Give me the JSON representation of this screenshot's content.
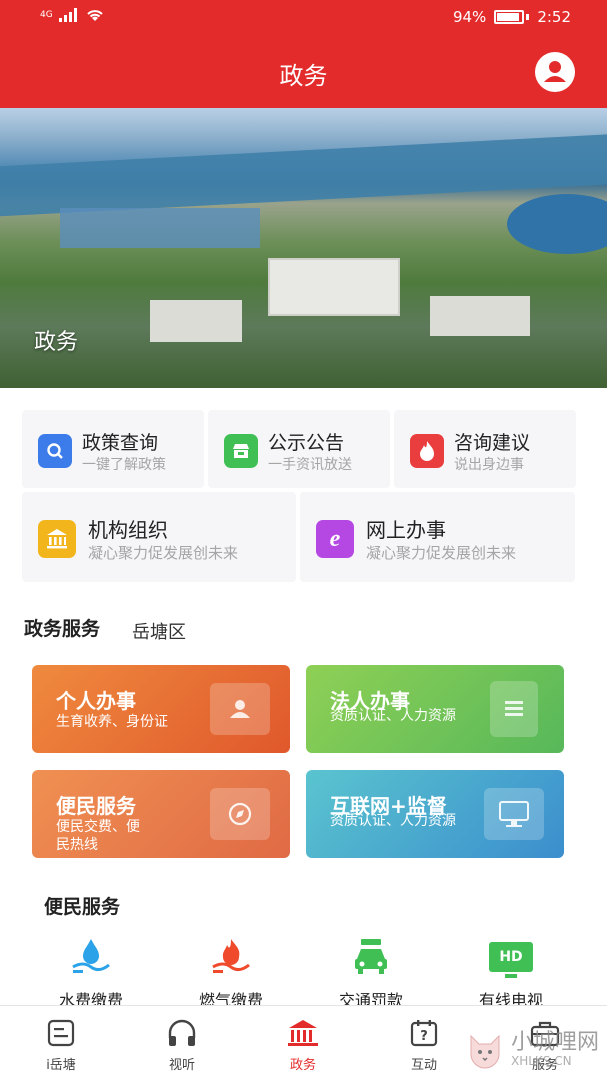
{
  "status_bar": {
    "signal": "4G",
    "battery": "94%",
    "time": "2:52"
  },
  "header": {
    "title": "政务"
  },
  "banner": {
    "label": "政务"
  },
  "quick_links": [
    {
      "title": "政策查询",
      "subtitle": "一键了解政策",
      "color": "#3b7bea"
    },
    {
      "title": "公示公告",
      "subtitle": "一手资讯放送",
      "color": "#3fbf54"
    },
    {
      "title": "咨询建议",
      "subtitle": "说出身边事",
      "color": "#ea3d3d"
    },
    {
      "title": "机构组织",
      "subtitle": "凝心聚力促发展创未来",
      "color": "#f2b51c"
    },
    {
      "title": "网上办事",
      "subtitle": "凝心聚力促发展创未来",
      "color": "#b548e3"
    }
  ],
  "services_section": {
    "title": "政务服务",
    "region": "岳塘区"
  },
  "services": [
    {
      "title": "个人办事",
      "desc": "生育收养、身份证",
      "color_from": "#ef8a3e",
      "color_to": "#e0582c"
    },
    {
      "title": "法人办事",
      "desc": "资质认证、人力资源",
      "color_from": "#8fd055",
      "color_to": "#57b85a"
    },
    {
      "title": "便民服务",
      "desc": "便民交费、便民热线",
      "color_from": "#f09052",
      "color_to": "#e06a45"
    },
    {
      "title": "互联网+监督",
      "desc": "资质认证、人力资源",
      "color_from": "#5ac4cf",
      "color_to": "#3b8ecd"
    }
  ],
  "convenience_section": {
    "title": "便民服务"
  },
  "utilities": [
    {
      "label": "水费缴费",
      "icon": "water-drop-icon"
    },
    {
      "label": "燃气缴费",
      "icon": "gas-flame-icon"
    },
    {
      "label": "交通罚款",
      "icon": "car-icon"
    },
    {
      "label": "有线电视",
      "icon": "hd-tv-icon",
      "badge": "HD"
    }
  ],
  "tabs": [
    {
      "label": "i岳塘",
      "active": false
    },
    {
      "label": "视听",
      "active": false
    },
    {
      "label": "政务",
      "active": true
    },
    {
      "label": "互动",
      "active": false
    },
    {
      "label": "服务",
      "active": false
    }
  ],
  "watermark": {
    "text": "小城哩网",
    "url": "XHLKS.CN"
  },
  "colors": {
    "brand_red": "#e32b2b"
  }
}
